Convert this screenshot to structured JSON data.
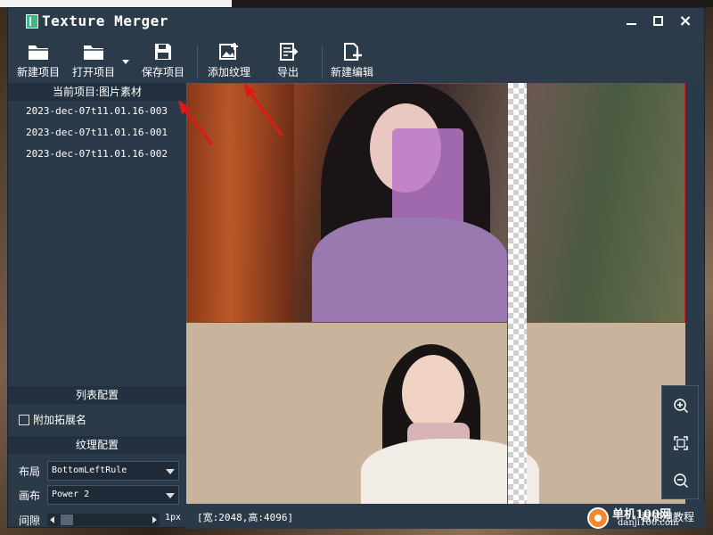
{
  "window": {
    "title": "Texture Merger",
    "controls": {
      "minimize": "minimize",
      "maximize": "maximize",
      "close": "×"
    }
  },
  "toolbar": {
    "items": [
      {
        "label": "新建项目",
        "icon": "folder-new-icon"
      },
      {
        "label": "打开项目",
        "icon": "folder-open-icon"
      },
      {
        "label": "保存项目",
        "icon": "save-icon"
      },
      {
        "label": "添加纹理",
        "icon": "add-image-icon"
      },
      {
        "label": "导出",
        "icon": "export-icon"
      },
      {
        "label": "新建编辑",
        "icon": "new-document-icon"
      }
    ]
  },
  "left_panel": {
    "project_header": "当前项目:图片素材",
    "items": [
      "2023-dec-07t11.01.16-003",
      "2023-dec-07t11.01.16-001",
      "2023-dec-07t11.01.16-002"
    ],
    "list_config_header": "列表配置",
    "checkbox_label": "附加拓展名",
    "checkbox_checked": false,
    "texture_config_header": "纹理配置",
    "layout": {
      "label": "布局",
      "value": "BottomLeftRule"
    },
    "canvas": {
      "label": "画布",
      "value": "Power 2"
    },
    "gap": {
      "label": "间隙",
      "value": "1px",
      "fraction": 0.05
    }
  },
  "status": {
    "text": "[宽:2048,高:4096]",
    "tutorial_link": "看使用教程",
    "watermark_main": "单机100网",
    "watermark_sub": "danji100.com"
  },
  "zoom_tools": [
    "zoom-in-icon",
    "fit-screen-icon",
    "zoom-out-icon"
  ],
  "colors": {
    "window_bg": "#2b3a48",
    "accent_red": "#d02020",
    "annotation_arrow": "#e01818"
  }
}
